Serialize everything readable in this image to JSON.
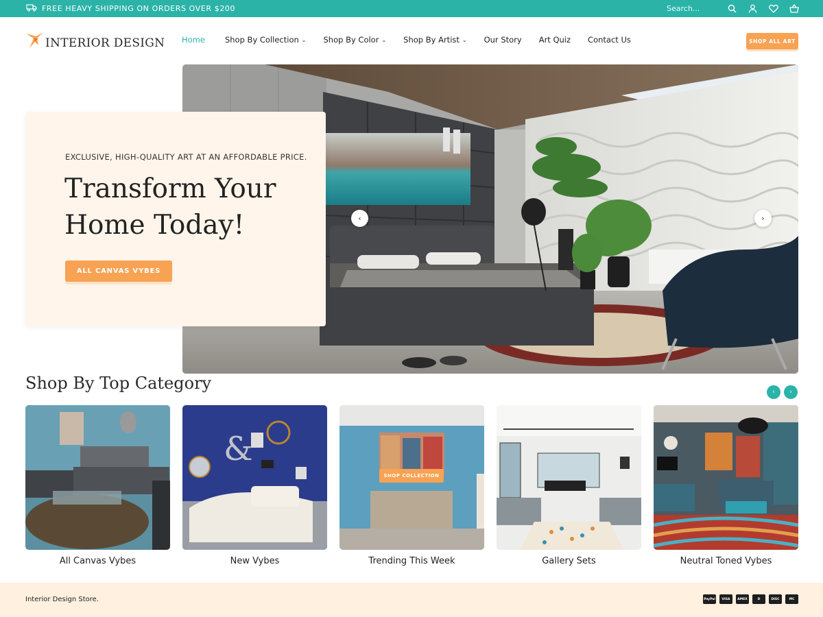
{
  "topbar": {
    "shipping_text": "FREE HEAVY SHIPPING ON ORDERS OVER $200",
    "search_placeholder": "Search...",
    "icons": [
      "truck-icon",
      "search-icon",
      "user-icon",
      "heart-icon",
      "basket-icon"
    ]
  },
  "header": {
    "logo_text": "INTERIOR DESIGN",
    "nav": [
      {
        "label": "Home",
        "active": true,
        "dropdown": false
      },
      {
        "label": "Shop By Collection",
        "active": false,
        "dropdown": true
      },
      {
        "label": "Shop By Color",
        "active": false,
        "dropdown": true
      },
      {
        "label": "Shop By Artist",
        "active": false,
        "dropdown": true
      },
      {
        "label": "Our Story",
        "active": false,
        "dropdown": false
      },
      {
        "label": "Art Quiz",
        "active": false,
        "dropdown": false
      },
      {
        "label": "Contact Us",
        "active": false,
        "dropdown": false
      }
    ],
    "shop_all_label": "SHOP ALL ART"
  },
  "hero": {
    "eyebrow": "EXCLUSIVE, HIGH-QUALITY ART AT AN AFFORDABLE PRICE.",
    "title_line1": "Transform Your",
    "title_line2": "Home Today!",
    "cta_label": "ALL CANVAS VYBES",
    "prev_arrow": "‹",
    "next_arrow": "›"
  },
  "categories": {
    "title": "Shop By Top Category",
    "prev_arrow": "‹",
    "next_arrow": "›",
    "overlay_button": "SHOP COLLECTION",
    "items": [
      {
        "label": "All Canvas Vybes"
      },
      {
        "label": "New Vybes"
      },
      {
        "label": "Trending This Week"
      },
      {
        "label": "Gallery Sets"
      },
      {
        "label": "Neutral Toned Vybes"
      }
    ]
  },
  "footer": {
    "store_text": "Interior Design Store.",
    "payments": [
      "PayPal",
      "VISA",
      "AMEX",
      "D",
      "DISC",
      "MC"
    ]
  },
  "colors": {
    "accent_teal": "#2bb3a8",
    "accent_orange": "#f8a253",
    "hero_card_bg": "#fff5eb",
    "footer_bg": "#fff0df"
  }
}
